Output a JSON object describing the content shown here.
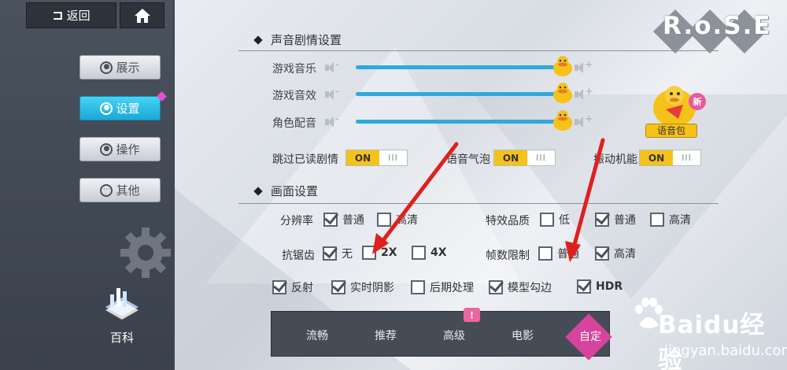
{
  "nav": {
    "back_label": "返回"
  },
  "logo": {
    "text": "R.o.S.E"
  },
  "sidebar": {
    "tabs": [
      {
        "label": "展示",
        "icon": "person-icon"
      },
      {
        "label": "设置",
        "icon": "gear-icon"
      },
      {
        "label": "操作",
        "icon": "person-icon"
      },
      {
        "label": "其他",
        "icon": "more-icon"
      }
    ],
    "active_tab": "设置",
    "encyclopedia_label": "百科"
  },
  "sound": {
    "title": "声音剧情设置",
    "sliders": [
      {
        "label": "游戏音乐",
        "value": 1.0
      },
      {
        "label": "游戏音效",
        "value": 1.0
      },
      {
        "label": "角色配音",
        "value": 1.0
      }
    ],
    "minus": "-",
    "plus": "+",
    "toggles": [
      {
        "label": "跳过已读剧情",
        "state": "ON"
      },
      {
        "label": "语音气泡",
        "state": "ON"
      },
      {
        "label": "振动机能",
        "state": "ON"
      }
    ],
    "toggle_grip": "III",
    "voice_pack": {
      "label": "语音包",
      "badge": "新"
    }
  },
  "graphics": {
    "title": "画面设置",
    "resolution": {
      "label": "分辨率",
      "options": [
        {
          "label": "普通",
          "checked": true
        },
        {
          "label": "高清",
          "checked": false
        }
      ]
    },
    "effects": {
      "label": "特效品质",
      "options": [
        {
          "label": "低",
          "checked": false
        },
        {
          "label": "普通",
          "checked": true
        },
        {
          "label": "高清",
          "checked": false
        }
      ]
    },
    "antialias": {
      "label": "抗锯齿",
      "options": [
        {
          "label": "无",
          "checked": true
        },
        {
          "label": "2X",
          "checked": false
        },
        {
          "label": "4X",
          "checked": false
        }
      ]
    },
    "framerate": {
      "label": "帧数限制",
      "options": [
        {
          "label": "普通",
          "checked": false
        },
        {
          "label": "高清",
          "checked": true
        }
      ]
    },
    "extras": [
      {
        "label": "反射",
        "checked": true
      },
      {
        "label": "实时阴影",
        "checked": true
      },
      {
        "label": "后期处理",
        "checked": false
      },
      {
        "label": "模型勾边",
        "checked": true
      },
      {
        "label": "HDR",
        "checked": true
      }
    ]
  },
  "presets": {
    "items": [
      "流畅",
      "推荐",
      "高级",
      "电影"
    ],
    "active": "自定",
    "flag": "!"
  },
  "watermark": {
    "brand": "Baidu经验",
    "url": "jingyan.baidu.com"
  },
  "colors": {
    "accent": "#31a8dc",
    "active_tab": "#1aa9d6",
    "toggle_on": "#f6c21a",
    "preset_active": "#d6449d",
    "arrow": "#e0201c"
  }
}
